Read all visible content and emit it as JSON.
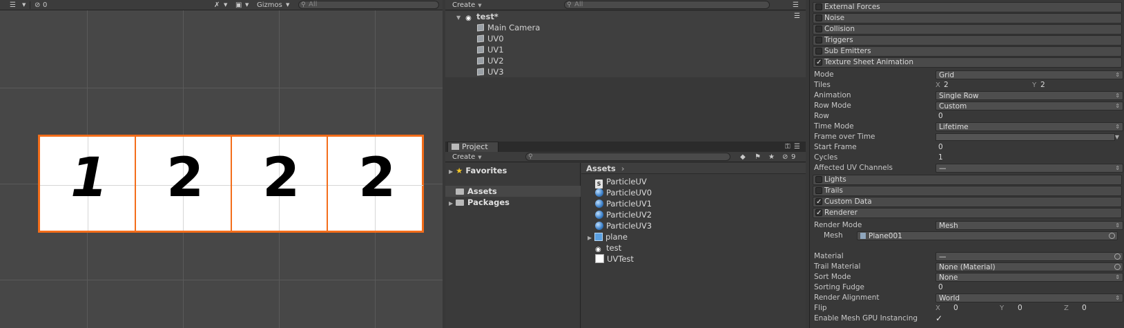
{
  "scene": {
    "toolbar": {
      "hidden_count": "0",
      "gizmos_label": "Gizmos",
      "search_placeholder": "All"
    },
    "cells": [
      "1",
      "2",
      "2",
      "2"
    ],
    "colors": {
      "outline": "#f36d1a",
      "background": "#474747"
    }
  },
  "hierarchy": {
    "create_label": "Create",
    "search_placeholder": "All",
    "scene_name": "test*",
    "objects": [
      "Main Camera",
      "UV0",
      "UV1",
      "UV2",
      "UV3"
    ]
  },
  "project": {
    "tab_label": "Project",
    "create_label": "Create",
    "hidden_count": "9",
    "tree": [
      {
        "label": "Favorites",
        "icon": "star-icon"
      },
      {
        "label": "Assets",
        "icon": "folder-icon"
      },
      {
        "label": "Packages",
        "icon": "folder-icon"
      }
    ],
    "breadcrumb": "Assets",
    "assets": [
      {
        "label": "ParticleUV",
        "icon": "script-icon"
      },
      {
        "label": "ParticleUV0",
        "icon": "material-sphere-icon"
      },
      {
        "label": "ParticleUV1",
        "icon": "material-sphere-icon"
      },
      {
        "label": "ParticleUV2",
        "icon": "material-sphere-icon"
      },
      {
        "label": "ParticleUV3",
        "icon": "material-sphere-icon"
      },
      {
        "label": "plane",
        "icon": "prefab-icon"
      },
      {
        "label": "test",
        "icon": "unity-scene-icon"
      },
      {
        "label": "UVTest",
        "icon": "texture-icon"
      }
    ]
  },
  "inspector": {
    "modules_top": [
      {
        "label": "External Forces",
        "checked": false
      },
      {
        "label": "Noise",
        "checked": false
      },
      {
        "label": "Collision",
        "checked": false
      },
      {
        "label": "Triggers",
        "checked": false
      },
      {
        "label": "Sub Emitters",
        "checked": false
      },
      {
        "label": "Texture Sheet Animation",
        "checked": true
      }
    ],
    "tsa": {
      "mode": {
        "label": "Mode",
        "value": "Grid"
      },
      "tiles": {
        "label": "Tiles",
        "x_label": "X",
        "x": "2",
        "y_label": "Y",
        "y": "2"
      },
      "animation": {
        "label": "Animation",
        "value": "Single Row"
      },
      "row_mode": {
        "label": "Row Mode",
        "value": "Custom"
      },
      "row": {
        "label": "Row",
        "value": "0"
      },
      "time_mode": {
        "label": "Time Mode",
        "value": "Lifetime"
      },
      "frame_over_time": {
        "label": "Frame over Time"
      },
      "start_frame": {
        "label": "Start Frame",
        "value": "0"
      },
      "cycles": {
        "label": "Cycles",
        "value": "1"
      },
      "affected_uv": {
        "label": "Affected UV Channels",
        "value": "—"
      }
    },
    "modules_mid": [
      {
        "label": "Lights",
        "checked": false
      },
      {
        "label": "Trails",
        "checked": false
      },
      {
        "label": "Custom Data",
        "checked": true
      },
      {
        "label": "Renderer",
        "checked": true
      }
    ],
    "renderer": {
      "render_mode": {
        "label": "Render Mode",
        "value": "Mesh"
      },
      "mesh": {
        "label": "Mesh",
        "value": "Plane001"
      },
      "material": {
        "label": "Material",
        "value": "—"
      },
      "trail_material": {
        "label": "Trail Material",
        "value": "None (Material)"
      },
      "sort_mode": {
        "label": "Sort Mode",
        "value": "None"
      },
      "sorting_fudge": {
        "label": "Sorting Fudge",
        "value": "0"
      },
      "render_alignment": {
        "label": "Render Alignment",
        "value": "World"
      },
      "flip": {
        "label": "Flip",
        "x_label": "X",
        "x": "0",
        "y_label": "Y",
        "y": "0",
        "z_label": "Z",
        "z": "0"
      },
      "gpu_instancing": {
        "label": "Enable Mesh GPU Instancing",
        "checked": true
      }
    }
  }
}
